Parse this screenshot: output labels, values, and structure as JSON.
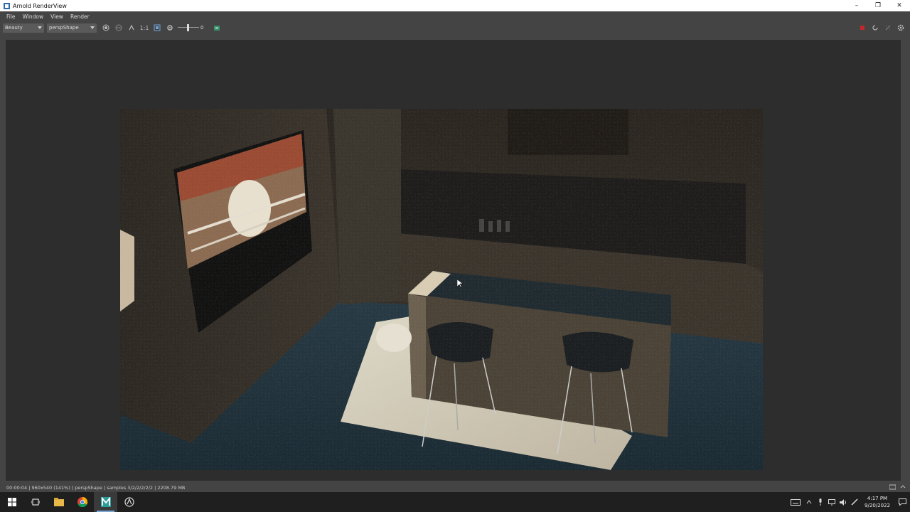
{
  "window": {
    "title": "Arnold RenderView",
    "controls": [
      "minimize-icon",
      "restore-icon",
      "close-icon"
    ]
  },
  "menubar": {
    "items": [
      "File",
      "Window",
      "View",
      "Render"
    ]
  },
  "toolbar": {
    "aov_select": "Beauty",
    "camera_select": "perspShape",
    "zoom_ratio": "1:1",
    "exposure_value": "0",
    "icons": [
      "channel-icon",
      "compare-icon",
      "refresh-icon",
      "crop-region-icon",
      "settings-icon",
      "render-stop-icon",
      "rerender-icon",
      "interactive-icon",
      "gear-icon"
    ]
  },
  "status": {
    "text": "00:00:04 | 960x540 (141%) | perspShape  | samples 3/2/2/2/2/2 | 2208.79 MB"
  },
  "taskbar": {
    "apps": [
      "windows-start-icon",
      "task-view-icon",
      "file-explorer-icon",
      "chrome-icon",
      "maya-icon",
      "arnold-icon"
    ],
    "time": "4:17 PM",
    "date": "9/20/2022"
  },
  "colors": {
    "panel": "#444444",
    "viewport": "#2d2d2d",
    "taskbar": "#1f1f1f"
  }
}
